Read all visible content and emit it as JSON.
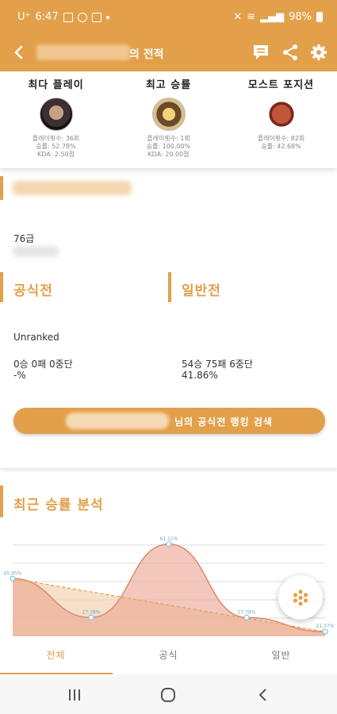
{
  "status": {
    "carrier": "U⁺",
    "time": "6:47",
    "battery": "98%"
  },
  "appbar": {
    "title_suffix": "의 전적"
  },
  "top_stats": [
    {
      "title": "최다 플레이",
      "lines": [
        "플레이횟수: 36회",
        "승률: 52.78%",
        "KDA: 2.50점"
      ]
    },
    {
      "title": "최고 승률",
      "lines": [
        "플레이횟수: 1회",
        "승률: 100.00%",
        "KDA: 20.00점"
      ]
    },
    {
      "title": "모스트 포지션",
      "lines": [
        "플레이횟수: 82회",
        "승률: 42.68%"
      ]
    }
  ],
  "level": "76급",
  "official": {
    "title": "공식전",
    "rank": "Unranked",
    "record": "0승 0패 0중단",
    "rate": "-%"
  },
  "casual": {
    "title": "일반전",
    "record": "54승 75패 6중단",
    "rate": "41.86%"
  },
  "rank_search_label": "님의 공식전 랭킹 검색",
  "recent": {
    "title": "최근 승률 분석"
  },
  "chart_data": {
    "type": "area",
    "series": [
      {
        "values": [
          45.45,
          27.78,
          61.11,
          27.78,
          21.37
        ]
      }
    ],
    "point_labels": [
      "45.45%",
      "27.78%",
      "61.11%",
      "27.78%",
      "21.37%"
    ]
  },
  "tabs": [
    "전체",
    "공식",
    "일반"
  ],
  "colors": {
    "accent": "#e3a04a",
    "area": "#e9a38f",
    "area_light": "#f3d3b2"
  }
}
